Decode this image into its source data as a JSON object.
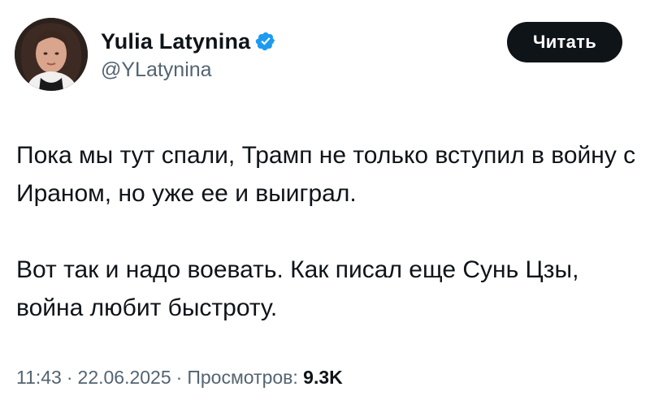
{
  "author": {
    "display_name": "Yulia Latynina",
    "handle": "@YLatynina",
    "verified": true,
    "avatar_icon": "profile-photo"
  },
  "follow_button": {
    "label": "Читать"
  },
  "tweet": {
    "paragraphs": [
      "Пока мы тут спали, Трамп не только вступил в войну с Ираном, но уже ее и выиграл.",
      "Вот так и надо воевать. Как писал еще Сунь Цзы, война любит быстроту."
    ]
  },
  "meta": {
    "time": "11:43",
    "separator": "·",
    "date": "22.06.2025",
    "views_label": "Просмотров:",
    "views_count": "9.3K"
  },
  "colors": {
    "text_primary": "#0f1419",
    "text_secondary": "#536471",
    "button_bg": "#0f1419",
    "button_text": "#ffffff",
    "verified_badge": "#1d9bf0"
  }
}
